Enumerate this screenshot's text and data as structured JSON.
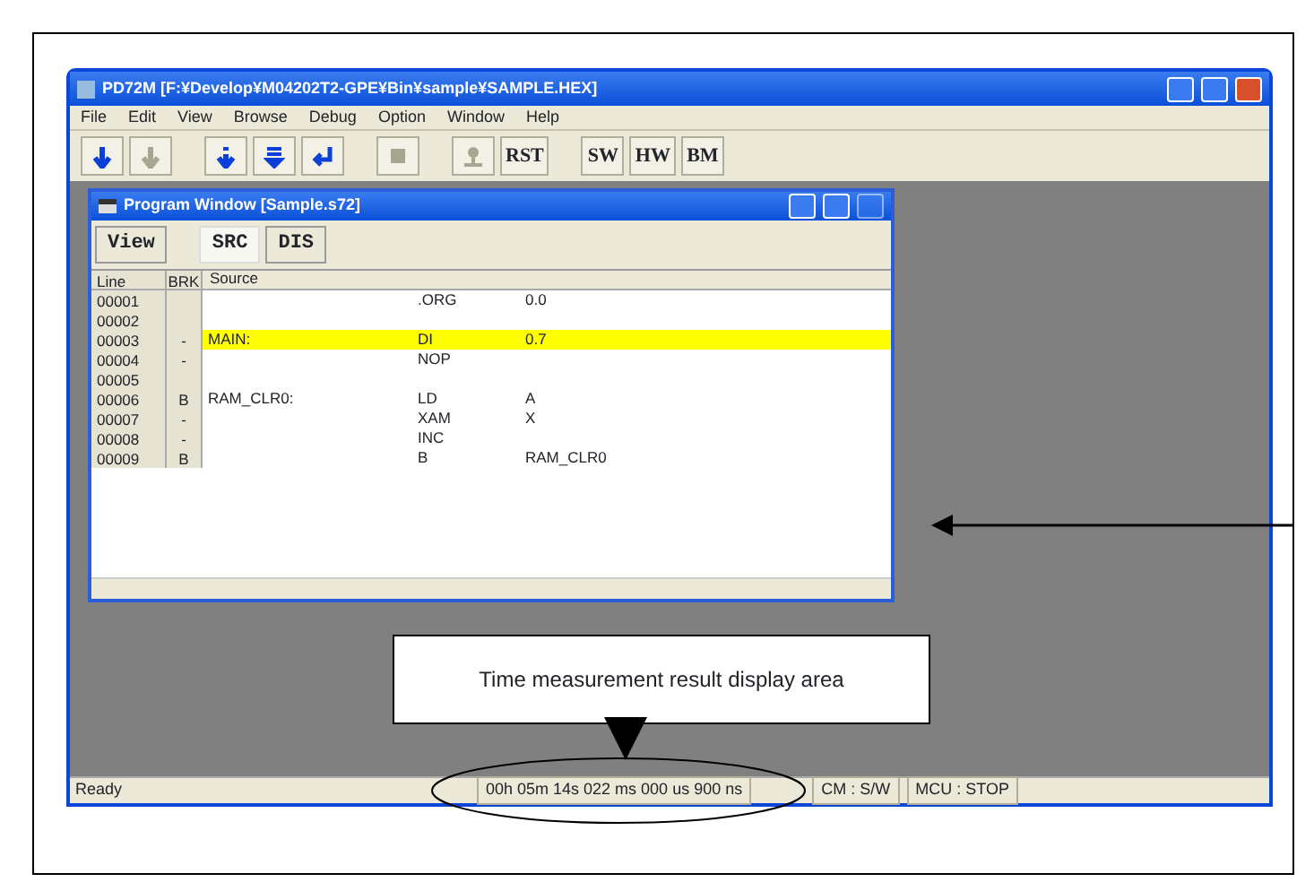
{
  "window": {
    "title": "PD72M [F:¥Develop¥M04202T2-GPE¥Bin¥sample¥SAMPLE.HEX]"
  },
  "menu": [
    "File",
    "Edit",
    "View",
    "Browse",
    "Debug",
    "Option",
    "Window",
    "Help"
  ],
  "toolbar": [
    {
      "kind": "down",
      "disabled": false
    },
    {
      "kind": "down",
      "disabled": true
    },
    {
      "kind": "gap"
    },
    {
      "kind": "step",
      "disabled": false
    },
    {
      "kind": "over",
      "disabled": false
    },
    {
      "kind": "return",
      "disabled": false
    },
    {
      "kind": "gap"
    },
    {
      "kind": "stop",
      "disabled": true
    },
    {
      "kind": "gap"
    },
    {
      "kind": "person",
      "disabled": true
    },
    {
      "kind": "text",
      "label": "RST",
      "disabled": false
    },
    {
      "kind": "gap"
    },
    {
      "kind": "text",
      "label": "SW",
      "disabled": false
    },
    {
      "kind": "text",
      "label": "HW",
      "disabled": false
    },
    {
      "kind": "text",
      "label": "BM",
      "disabled": false
    }
  ],
  "program_window": {
    "title": "Program Window [Sample.s72]",
    "view_button": "View",
    "tabs": [
      {
        "label": "SRC",
        "selected": true
      },
      {
        "label": "DIS",
        "selected": false
      }
    ],
    "columns": [
      "Line",
      "BRK",
      "Source"
    ],
    "rows": [
      {
        "line": "00001",
        "brk": "",
        "label": "",
        "op": ".ORG",
        "operand": "0.0",
        "selected": false
      },
      {
        "line": "00002",
        "brk": "",
        "label": "",
        "op": "",
        "operand": "",
        "selected": false
      },
      {
        "line": "00003",
        "brk": "-",
        "label": "MAIN:",
        "op": "DI",
        "operand": "0.7",
        "selected": true
      },
      {
        "line": "00004",
        "brk": "-",
        "label": "",
        "op": "NOP",
        "operand": "",
        "selected": false
      },
      {
        "line": "00005",
        "brk": "",
        "label": "",
        "op": "",
        "operand": "",
        "selected": false
      },
      {
        "line": "00006",
        "brk": "B",
        "label": "RAM_CLR0:",
        "op": "LD",
        "operand": "A",
        "selected": false
      },
      {
        "line": "00007",
        "brk": "-",
        "label": "",
        "op": "XAM",
        "operand": "X",
        "selected": false
      },
      {
        "line": "00008",
        "brk": "-",
        "label": "",
        "op": "INC",
        "operand": "",
        "selected": false
      },
      {
        "line": "00009",
        "brk": "B",
        "label": "",
        "op": "B",
        "operand": "RAM_CLR0",
        "selected": false
      }
    ]
  },
  "status_bar": [
    "Ready",
    "00h 05m 14s 022 ms 000 us 900 ns",
    "CM : S/W",
    "MCU : STOP"
  ],
  "annotation": {
    "text": "Time measurement result display area"
  }
}
